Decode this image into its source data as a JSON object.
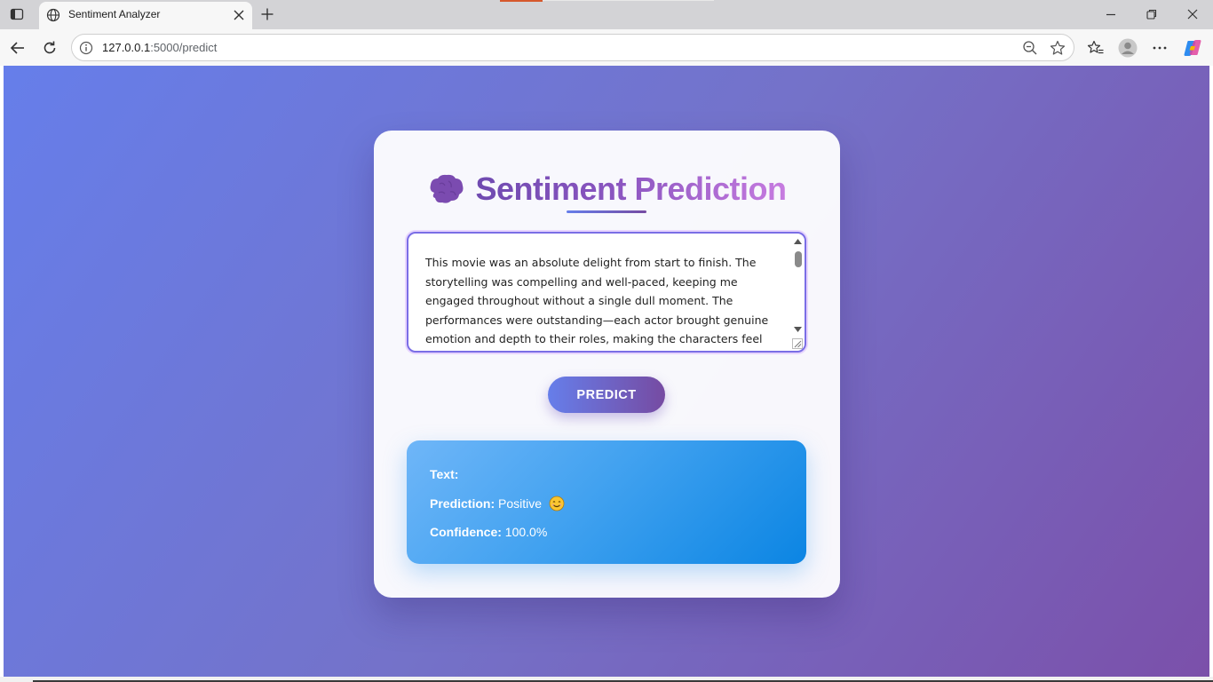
{
  "browser": {
    "tab_title": "Sentiment Analyzer",
    "url_host": "127.0.0.1",
    "url_path": ":5000/predict",
    "icons": [
      "sidebar-toggle-icon",
      "globe-icon",
      "close-icon",
      "plus-icon",
      "minimize-icon",
      "restore-icon",
      "back-icon",
      "reload-icon",
      "info-icon",
      "zoom-out-icon",
      "star-icon",
      "favorites-icon",
      "profile-icon",
      "more-icon",
      "copilot-icon"
    ]
  },
  "card": {
    "title": "Sentiment Prediction",
    "icon": "brain-icon",
    "review_text": "This movie was an absolute delight from start to finish. The storytelling was compelling and well-paced, keeping me engaged throughout without a single dull moment. The performances were outstanding—each actor brought genuine emotion and depth to their roles, making the characters feel real and relatable. Visually,",
    "predict_label": "PREDICT"
  },
  "result": {
    "text_label": "Text:",
    "text_value": "",
    "prediction_label": "Prediction:",
    "prediction_value": "Positive",
    "prediction_icon": "smiling-face-icon",
    "confidence_label": "Confidence:",
    "confidence_value": "100.0%"
  },
  "colors": {
    "bg_gradient_start": "#667eea",
    "bg_gradient_end": "#764ba2",
    "result_gradient_start": "#6fb6f8",
    "result_gradient_end": "#0b85e3"
  }
}
